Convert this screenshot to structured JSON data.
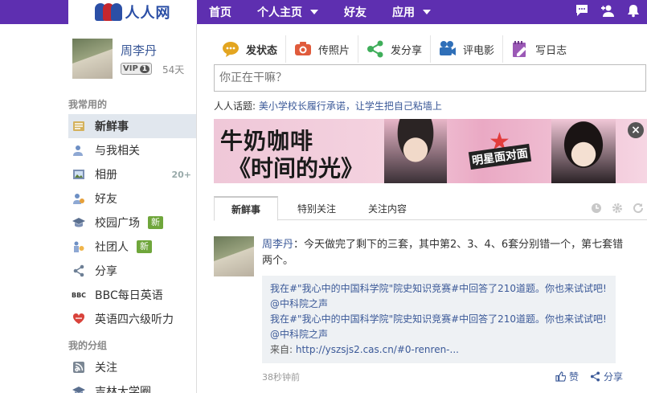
{
  "brand": {
    "logo_text": "人人网",
    "accent": "#5e2fb0"
  },
  "nav": {
    "items": [
      {
        "label": "首页",
        "dropdown": false
      },
      {
        "label": "个人主页",
        "dropdown": true
      },
      {
        "label": "好友",
        "dropdown": false
      },
      {
        "label": "应用",
        "dropdown": true
      }
    ],
    "icons": [
      "chat-bubble-icon",
      "add-friend-icon",
      "bell-icon"
    ]
  },
  "profile": {
    "name": "周李丹",
    "vip_label": "VIP",
    "vip_level": "1",
    "days": "54天"
  },
  "sidebar": {
    "section_common": "我常用的",
    "common_items": [
      {
        "label": "新鲜事",
        "icon": "news-feed-icon",
        "active": true
      },
      {
        "label": "与我相关",
        "icon": "related-to-me-icon"
      },
      {
        "label": "相册",
        "icon": "photo-album-icon",
        "count": "20+"
      },
      {
        "label": "好友",
        "icon": "friends-icon"
      },
      {
        "label": "校园广场",
        "icon": "campus-plaza-icon",
        "badge": "新"
      },
      {
        "label": "社团人",
        "icon": "club-icon",
        "badge": "新"
      },
      {
        "label": "分享",
        "icon": "share-icon"
      },
      {
        "label": "BBC每日英语",
        "icon": "bbc-icon",
        "icon_text": "BBC"
      },
      {
        "label": "英语四六级听力",
        "icon": "english-listening-icon"
      }
    ],
    "section_groups": "我的分组",
    "group_items": [
      {
        "label": "关注",
        "icon": "follow-icon"
      },
      {
        "label": "吉林大学圈",
        "icon": "university-circle-icon"
      }
    ]
  },
  "publisher": {
    "tabs": [
      {
        "label": "发状态",
        "icon": "status-bubble-icon",
        "active": true
      },
      {
        "label": "传照片",
        "icon": "camera-icon"
      },
      {
        "label": "发分享",
        "icon": "share-nodes-icon"
      },
      {
        "label": "评电影",
        "icon": "movie-camera-icon"
      },
      {
        "label": "写日志",
        "icon": "notebook-icon"
      }
    ],
    "status_placeholder": "你正在干嘛？",
    "topic_label": "人人话题:",
    "topic_text": "美小学校长履行承诺，让学生把自己粘墙上"
  },
  "banner": {
    "title": "牛奶咖啡",
    "subtitle": "《时间的光》",
    "badge": "明星面对面",
    "close": "×"
  },
  "feed_tabs": [
    {
      "label": "新鲜事",
      "active": true
    },
    {
      "label": "特别关注"
    },
    {
      "label": "关注内容"
    }
  ],
  "feed": {
    "author": "周李丹",
    "text": "：今天做完了剩下的三套，其中第2、3、4、6套分别错一个，第七套错两个。",
    "quote_lines": [
      "我在#\"我心中的中国科学院\"院史知识竞赛#中回答了210道题。你也来试试吧!",
      "@中科院之声",
      "我在#\"我心中的中国科学院\"院史知识竞赛#中回答了210道题。你也来试试吧!",
      "@中科院之声"
    ],
    "source_label": "来自:",
    "source_link": "http://yszsjs2.cas.cn/#0-renren-...",
    "time": "38秒钟前",
    "like_label": "赞",
    "share_label": "分享"
  }
}
